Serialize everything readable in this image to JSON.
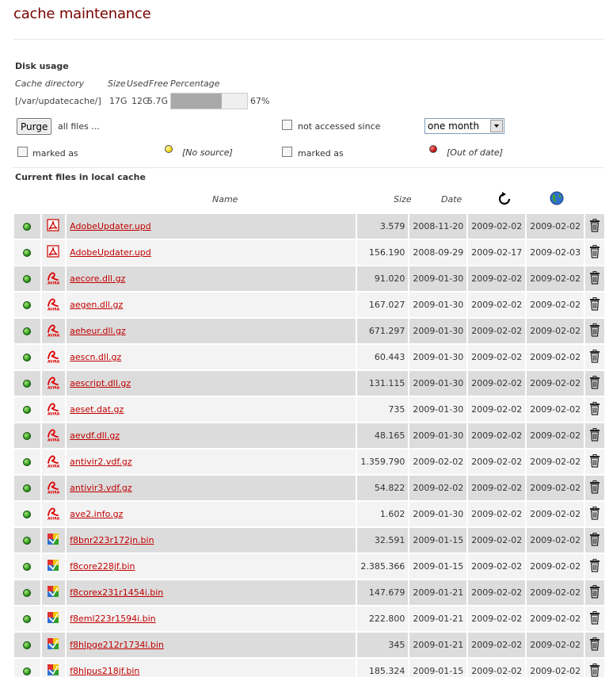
{
  "page": {
    "title": "cache maintenance"
  },
  "disk_usage": {
    "heading": "Disk usage",
    "columns": [
      "Cache directory",
      "Size",
      "Used",
      "Free",
      "Percentage"
    ],
    "directory": "[/var/updatecache/]",
    "size": "17G",
    "used": "12G",
    "free": "5.7G",
    "percent_value": 67,
    "percent_label": "67%"
  },
  "controls": {
    "purge_label": "Purge",
    "all_files_label": "all files ...",
    "not_accessed_label": "not accessed since",
    "period_selected": "one month",
    "marked_as_label_1": "marked as",
    "no_source_label": "[No source]",
    "marked_as_label_2": "marked as",
    "out_of_date_label": "[Out of date]",
    "no_source_color": "#f2d100",
    "out_of_date_color": "#b00000"
  },
  "files_section": {
    "heading": "Current files in local cache",
    "columns": {
      "name": "Name",
      "size": "Size",
      "date": "Date"
    },
    "header_icons": [
      "refresh-icon",
      "globe-icon"
    ]
  },
  "files": [
    {
      "name": "AdobeUpdater.upd",
      "type": "adobe",
      "size": "3.579",
      "date": "2008-11-20",
      "accessed": "2009-02-02",
      "checked": "2009-02-02"
    },
    {
      "name": "AdobeUpdater.upd",
      "type": "adobe",
      "size": "156.190",
      "date": "2008-09-29",
      "accessed": "2009-02-17",
      "checked": "2009-02-03"
    },
    {
      "name": "aecore.dll.gz",
      "type": "avira",
      "size": "91.020",
      "date": "2009-01-30",
      "accessed": "2009-02-02",
      "checked": "2009-02-02"
    },
    {
      "name": "aegen.dll.gz",
      "type": "avira",
      "size": "167.027",
      "date": "2009-01-30",
      "accessed": "2009-02-02",
      "checked": "2009-02-02"
    },
    {
      "name": "aeheur.dll.gz",
      "type": "avira",
      "size": "671.297",
      "date": "2009-01-30",
      "accessed": "2009-02-02",
      "checked": "2009-02-02"
    },
    {
      "name": "aescn.dll.gz",
      "type": "avira",
      "size": "60.443",
      "date": "2009-01-30",
      "accessed": "2009-02-02",
      "checked": "2009-02-02"
    },
    {
      "name": "aescript.dll.gz",
      "type": "avira",
      "size": "131.115",
      "date": "2009-01-30",
      "accessed": "2009-02-02",
      "checked": "2009-02-02"
    },
    {
      "name": "aeset.dat.gz",
      "type": "avira",
      "size": "735",
      "date": "2009-01-30",
      "accessed": "2009-02-02",
      "checked": "2009-02-02"
    },
    {
      "name": "aevdf.dll.gz",
      "type": "avira",
      "size": "48.165",
      "date": "2009-01-30",
      "accessed": "2009-02-02",
      "checked": "2009-02-02"
    },
    {
      "name": "antivir2.vdf.gz",
      "type": "avira",
      "size": "1.359.790",
      "date": "2009-02-02",
      "accessed": "2009-02-02",
      "checked": "2009-02-02"
    },
    {
      "name": "antivir3.vdf.gz",
      "type": "avira",
      "size": "54.822",
      "date": "2009-02-02",
      "accessed": "2009-02-02",
      "checked": "2009-02-02"
    },
    {
      "name": "ave2.info.gz",
      "type": "avira",
      "size": "1.602",
      "date": "2009-01-30",
      "accessed": "2009-02-02",
      "checked": "2009-02-02"
    },
    {
      "name": "f8bnr223r172jn.bin",
      "type": "avg",
      "size": "32.591",
      "date": "2009-01-15",
      "accessed": "2009-02-02",
      "checked": "2009-02-02"
    },
    {
      "name": "f8core228jf.bin",
      "type": "avg",
      "size": "2.385.366",
      "date": "2009-01-15",
      "accessed": "2009-02-02",
      "checked": "2009-02-02"
    },
    {
      "name": "f8corex231r1454i.bin",
      "type": "avg",
      "size": "147.679",
      "date": "2009-01-21",
      "accessed": "2009-02-02",
      "checked": "2009-02-02"
    },
    {
      "name": "f8eml223r1594i.bin",
      "type": "avg",
      "size": "222.800",
      "date": "2009-01-21",
      "accessed": "2009-02-02",
      "checked": "2009-02-02"
    },
    {
      "name": "f8hlpge212r1734l.bin",
      "type": "avg",
      "size": "345",
      "date": "2009-01-21",
      "accessed": "2009-02-02",
      "checked": "2009-02-02"
    },
    {
      "name": "f8hlpus218jf.bin",
      "type": "avg",
      "size": "185.324",
      "date": "2009-01-15",
      "accessed": "2009-02-02",
      "checked": "2009-02-02"
    }
  ]
}
